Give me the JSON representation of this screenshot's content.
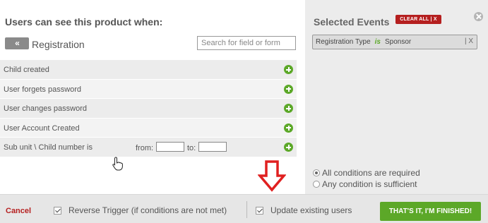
{
  "left": {
    "title": "Users can see this product when:",
    "back_label": "«",
    "crumb": "Registration",
    "search_placeholder": "Search for field or form",
    "rows": [
      {
        "label": "Child created"
      },
      {
        "label": "User forgets password"
      },
      {
        "label": "User changes password"
      },
      {
        "label": "User Account Created"
      },
      {
        "label": "Sub unit \\ Child number is",
        "from_label": "from:",
        "to_label": "to:"
      }
    ]
  },
  "right": {
    "title": "Selected Events",
    "clear_label": "CLEAR ALL | X",
    "event": {
      "field": "Registration Type",
      "operator": "is",
      "value": "Sponsor",
      "remove": "| X"
    },
    "radios": [
      {
        "label": "All conditions are required",
        "checked": true
      },
      {
        "label": "Any condition is sufficient",
        "checked": false
      }
    ]
  },
  "footer": {
    "cancel": "Cancel",
    "reverse_trigger": "Reverse Trigger (if conditions are not met)",
    "update_users": "Update existing users",
    "finish": "THAT'S IT, I'M FINISHED!"
  },
  "colors": {
    "accent_green": "#5ca828",
    "danger_red": "#b51f1f",
    "annotation_red": "#e02020"
  },
  "icons": [
    "plus-circle-icon",
    "close-circle-icon",
    "hand-cursor-icon",
    "down-arrow-icon",
    "checkmark-icon"
  ]
}
